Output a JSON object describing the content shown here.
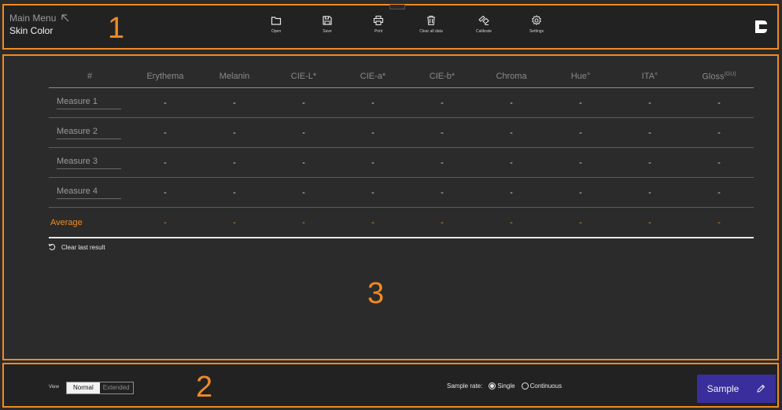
{
  "header": {
    "main_menu_label": "Main Menu",
    "page_title": "Skin Color",
    "section_number": "1",
    "tools": [
      {
        "label": "Open",
        "icon": "folder-icon"
      },
      {
        "label": "Save",
        "icon": "save-icon"
      },
      {
        "label": "Print",
        "icon": "print-icon"
      },
      {
        "label": "Clear all data",
        "icon": "trash-icon"
      },
      {
        "label": "Calibrate",
        "icon": "calibrate-icon"
      },
      {
        "label": "Settings",
        "icon": "gear-icon"
      }
    ],
    "logo_icon": "brand-logo-icon"
  },
  "results": {
    "columns": [
      "#",
      "Erythema",
      "Melanin",
      "CIE-L*",
      "CIE-a*",
      "CIE-b*",
      "Chroma",
      "Hue°",
      "ITA°",
      "Gloss"
    ],
    "gloss_unit": "(GU)",
    "rows": [
      {
        "label": "Measure 1",
        "values": [
          "-",
          "-",
          "-",
          "-",
          "-",
          "-",
          "-",
          "-",
          "-"
        ]
      },
      {
        "label": "Measure 2",
        "values": [
          "-",
          "-",
          "-",
          "-",
          "-",
          "-",
          "-",
          "-",
          "-"
        ]
      },
      {
        "label": "Measure 3",
        "values": [
          "-",
          "-",
          "-",
          "-",
          "-",
          "-",
          "-",
          "-",
          "-"
        ]
      },
      {
        "label": "Measure 4",
        "values": [
          "-",
          "-",
          "-",
          "-",
          "-",
          "-",
          "-",
          "-",
          "-"
        ]
      }
    ],
    "average": {
      "label": "Average",
      "values": [
        "-",
        "-",
        "-",
        "-",
        "-",
        "-",
        "-",
        "-",
        "-"
      ]
    },
    "clear_last_label": "Clear last result",
    "section_number": "3"
  },
  "footer": {
    "section_number": "2",
    "view_label": "View",
    "view_options": [
      "Normal",
      "Extended"
    ],
    "view_selected": "Normal",
    "sample_rate_label": "Sample rate:",
    "sample_rate_options": [
      "Single",
      "Continuous"
    ],
    "sample_rate_selected": "Single",
    "sample_button_label": "Sample"
  },
  "colors": {
    "accent": "#f08a24",
    "sample_button": "#3a2e9c",
    "background": "#2b2b2b",
    "bar_background": "#222222"
  }
}
